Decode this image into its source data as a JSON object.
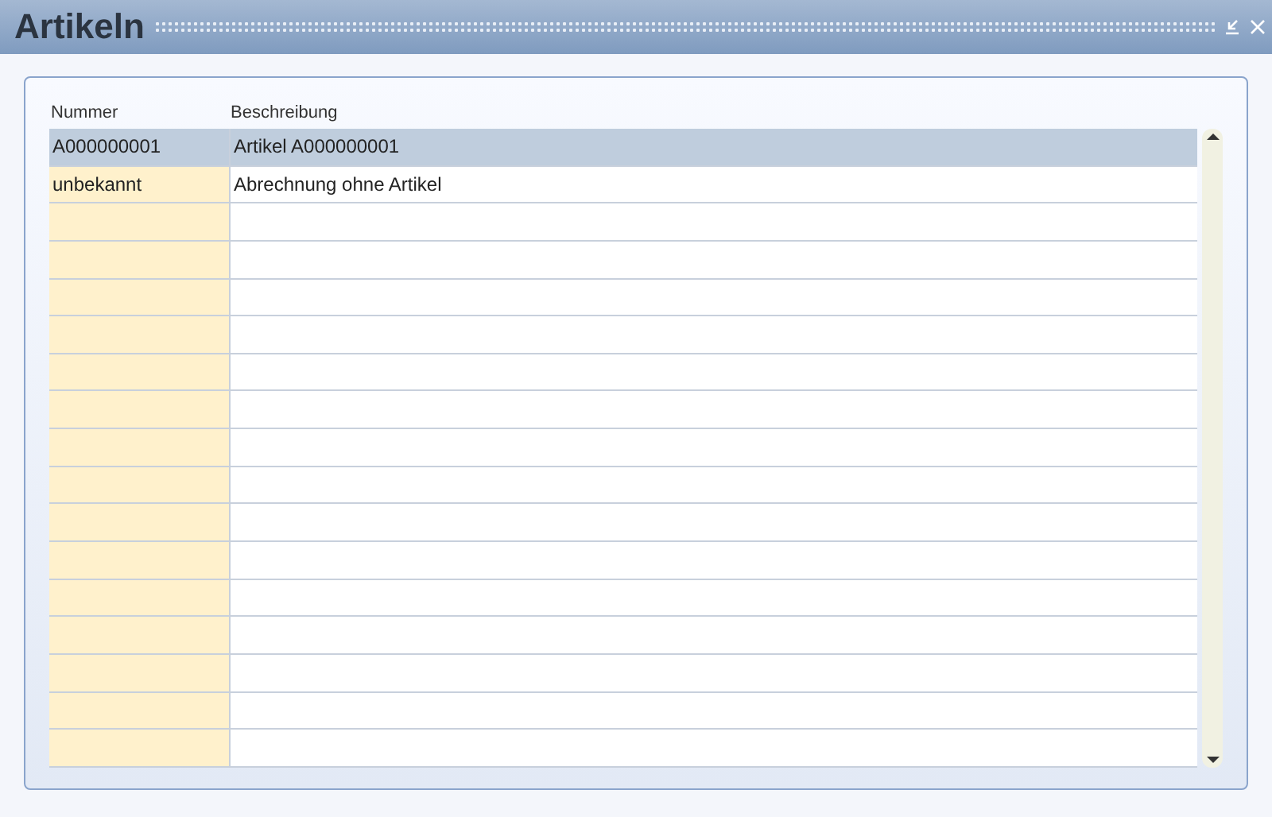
{
  "window": {
    "title": "Artikeln"
  },
  "table": {
    "columns": [
      "Nummer",
      "Beschreibung"
    ],
    "rows": [
      {
        "cells": [
          "A000000001",
          "Artikel A000000001"
        ],
        "selected": true
      },
      {
        "cells": [
          "unbekannt",
          "Abrechnung ohne Artikel"
        ],
        "selected": false
      }
    ]
  }
}
